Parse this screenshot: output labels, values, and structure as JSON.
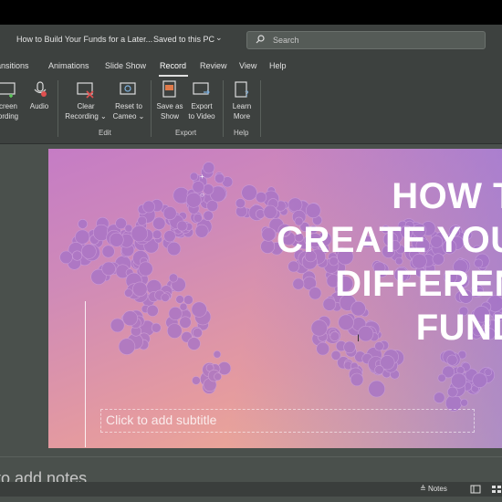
{
  "titlebar": {
    "doc_title": "How to Build Your Funds for a Later...",
    "saved": "Saved to this PC",
    "search_placeholder": "Search"
  },
  "tabs": [
    {
      "label": "ansitions"
    },
    {
      "label": "Animations"
    },
    {
      "label": "Slide Show"
    },
    {
      "label": "Record",
      "active": true
    },
    {
      "label": "Review"
    },
    {
      "label": "View"
    },
    {
      "label": "Help"
    }
  ],
  "ribbon": {
    "screen_rec": {
      "line1": "creen",
      "line2": "ording"
    },
    "audio": "Audio",
    "clear": {
      "line1": "Clear",
      "line2": "Recording ⌄"
    },
    "reset": {
      "line1": "Reset to",
      "line2": "Cameo ⌄"
    },
    "save_show": {
      "line1": "Save as",
      "line2": "Show"
    },
    "export_video": {
      "line1": "Export",
      "line2": "to Video"
    },
    "learn": {
      "line1": "Learn",
      "line2": "More"
    },
    "groups": {
      "edit": "Edit",
      "export": "Export",
      "help": "Help"
    }
  },
  "slide": {
    "title_lines": [
      "HOW TO",
      "CREATE YOUR",
      "DIFFERENT",
      "FUNDS"
    ],
    "subtitle_placeholder": "Click to add subtitle"
  },
  "notes": {
    "placeholder": "to add notes"
  },
  "status": {
    "notes_button": "Notes"
  },
  "colors": {
    "accent": "#c57cc5",
    "chrome": "#3d413f"
  }
}
